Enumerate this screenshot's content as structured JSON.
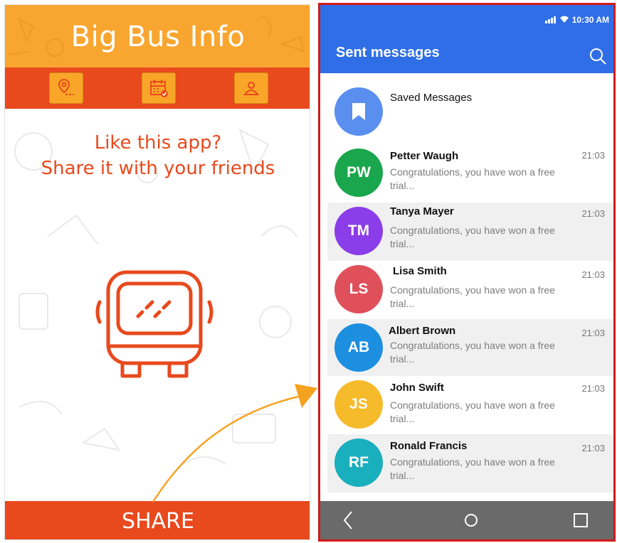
{
  "left_app": {
    "title": "Big Bus Info",
    "nav_icons": [
      "map-pin-icon",
      "calendar-icon",
      "profile-icon"
    ],
    "cta_line1": "Like this app?",
    "cta_line2": "Share it with your friends",
    "share_label": "SHARE",
    "colors": {
      "header": "#f8a630",
      "accent": "#e8491d",
      "button": "#f9a628"
    }
  },
  "right_app": {
    "status": {
      "time": "10:30 AM"
    },
    "title": "Sent messages",
    "saved": {
      "label": "Saved Messages"
    },
    "contacts": [
      {
        "initials": "PW",
        "name": "Petter Waugh",
        "time": "21:03",
        "message": "Congratulations, you have won a free trial...",
        "color": "#1aa64c"
      },
      {
        "initials": "TM",
        "name": "Tanya Mayer",
        "time": "21:03",
        "message": "Congratulations, you have won a free trial...",
        "color": "#8a3de8"
      },
      {
        "initials": "LS",
        "name": "Lisa Smith",
        "time": "21:03",
        "message": "Congratulations, you have won a free trial...",
        "color": "#e0505b"
      },
      {
        "initials": "AB",
        "name": "Albert Brown",
        "time": "21:03",
        "message": "Congratulations, you have won a free trial...",
        "color": "#1c8fe0"
      },
      {
        "initials": "JS",
        "name": "John Swift",
        "time": "21:03",
        "message": "Congratulations, you have won a free trial...",
        "color": "#f6bb2a"
      },
      {
        "initials": "RF",
        "name": "Ronald Francis",
        "time": "21:03",
        "message": "Congratulations, you have won a free trial...",
        "color": "#1aafbd"
      }
    ],
    "colors": {
      "appbar": "#2f6ee6",
      "frame": "#d31a1a",
      "navbar": "#6a6a6a"
    }
  }
}
